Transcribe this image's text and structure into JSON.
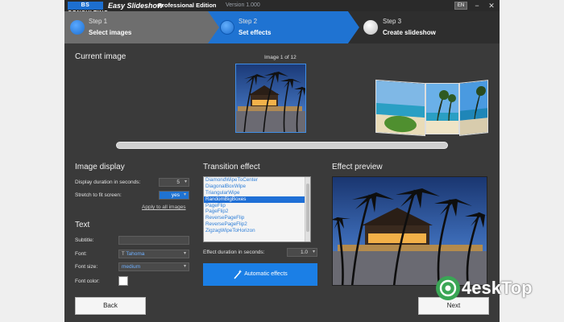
{
  "window": {
    "logo": "BS CONSULTING",
    "title": "Easy Slideshow",
    "edition": "Professional Edition",
    "version": "Version 1.000",
    "lang": "EN",
    "min": "−",
    "close": "✕"
  },
  "steps": [
    {
      "num": "Step 1",
      "name": "Select images"
    },
    {
      "num": "Step 2",
      "name": "Set effects"
    },
    {
      "num": "Step 3",
      "name": "Create slideshow"
    }
  ],
  "current_image": {
    "heading": "Current image",
    "counter": "Image 1 of 12"
  },
  "image_display": {
    "heading": "Image display",
    "duration_label": "Display duration in seconds:",
    "duration_value": "5",
    "stretch_label": "Stretch to fit screen:",
    "stretch_value": "yes",
    "apply_all": "Apply to all images"
  },
  "text": {
    "heading": "Text",
    "subtitle_label": "Subtitle:",
    "subtitle_value": "",
    "font_label": "Font:",
    "font_value": "Tahoma",
    "size_label": "Font size:",
    "size_value": "medium",
    "color_label": "Font color:"
  },
  "transition": {
    "heading": "Transition effect",
    "items": [
      "DiamondWipeToCenter",
      "DiagonalBoxWipe",
      "TriangularWipe",
      "RandomBigBoxes",
      "PageFlip",
      "PageFlip2",
      "ReversePageFlip",
      "ReversePageFlip2",
      "ZigzagWipeToHorizon"
    ],
    "selected_index": 3,
    "duration_label": "Effect duration in seconds:",
    "duration_value": "1.0",
    "auto_button": "Automatic effects"
  },
  "preview": {
    "heading": "Effect preview"
  },
  "nav": {
    "back": "Back",
    "next": "Next"
  },
  "watermark": "4eskTop",
  "colors": {
    "accent": "#1b7fe6",
    "panel": "#3a3a3a",
    "step_active": "#1f73d2"
  }
}
